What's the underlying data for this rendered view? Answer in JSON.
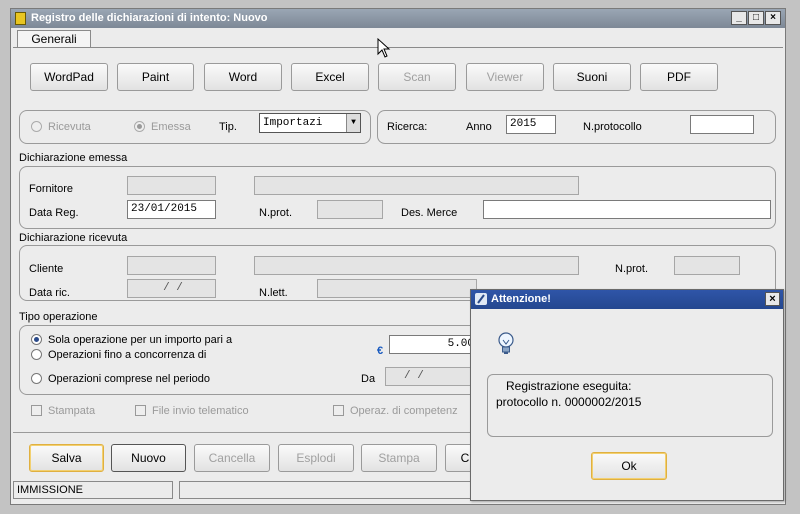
{
  "window": {
    "title": "Registro delle dichiarazioni di intento: Nuovo",
    "btn_min": "_",
    "btn_max": "□",
    "btn_close": "×"
  },
  "tab": "Generali",
  "toolbar": [
    "WordPad",
    "Paint",
    "Word",
    "Excel",
    "Scan",
    "Viewer",
    "Suoni",
    "PDF"
  ],
  "filter": {
    "ricevuta": "Ricevuta",
    "emessa": "Emessa",
    "tip_label": "Tip.",
    "tip_value": "Importazi",
    "ricerca_label": "Ricerca:",
    "anno_label": "Anno",
    "anno_value": "2015",
    "nprot_label": "N.protocollo",
    "nprot_value": ""
  },
  "emessa": {
    "section": "Dichiarazione emessa",
    "fornitore": "Fornitore",
    "data_reg": "Data Reg.",
    "data_reg_value": "23/01/2015",
    "nprot": "N.prot.",
    "des_merce": "Des. Merce"
  },
  "ricevuta": {
    "section": "Dichiarazione ricevuta",
    "cliente": "Cliente",
    "nprot": "N.prot.",
    "data_ric": "Data ric.",
    "data_ric_value": "/ /",
    "nlett": "N.lett.",
    "right_date": "/ /"
  },
  "tipo": {
    "section": "Tipo operazione",
    "opt1": "Sola operazione per un importo pari a",
    "opt2": "Operazioni fino a concorrenza di",
    "opt3": "Operazioni comprese nel periodo",
    "currency": "€",
    "importo": "5.00",
    "da": "Da",
    "da_value": "/ /"
  },
  "flags": {
    "stampata": "Stampata",
    "file_invio": "File invio telematico",
    "operaz": "Operaz. di competenz"
  },
  "actions": [
    "Salva",
    "Nuovo",
    "Cancella",
    "Esplodi",
    "Stampa",
    "C"
  ],
  "statusbar": {
    "mode": "IMMISSIONE"
  },
  "dialog": {
    "title": "Attenzione!",
    "close": "×",
    "line1": "Registrazione eseguita:",
    "line2": "protocollo n. 0000002/2015",
    "ok": "Ok"
  }
}
